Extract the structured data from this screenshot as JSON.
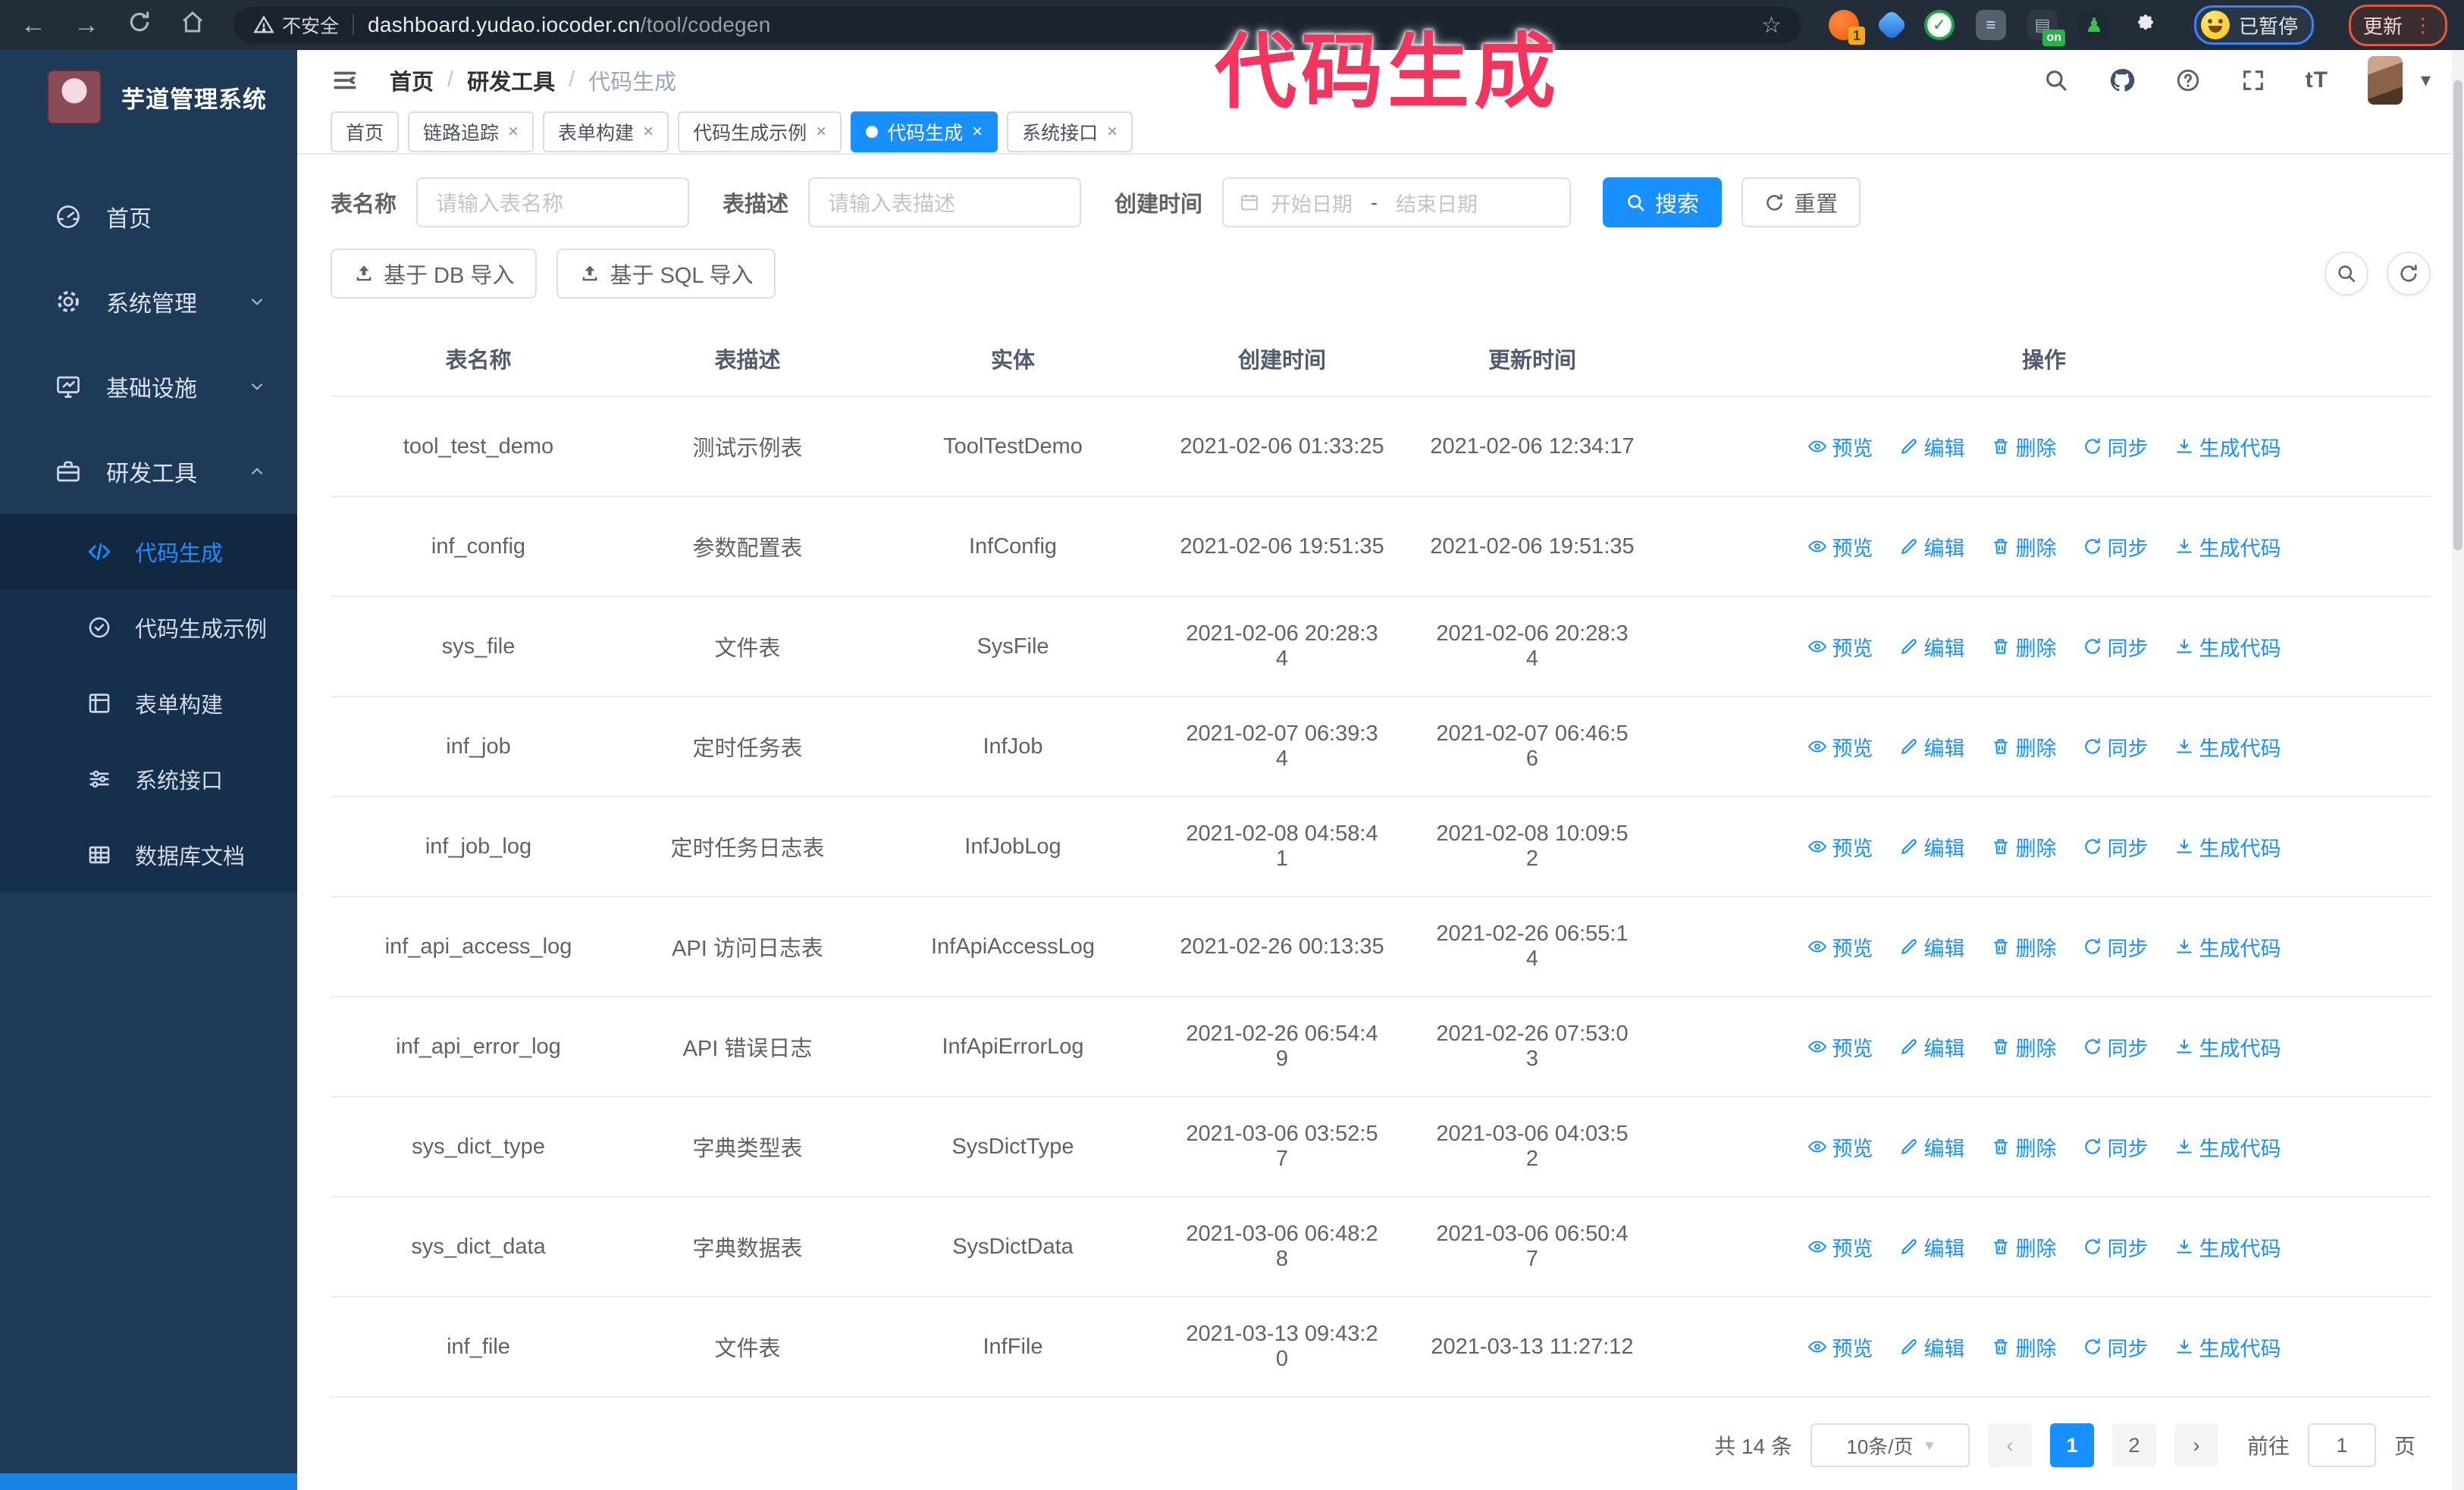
{
  "colors": {
    "accent": "#1890ff",
    "sidebar_bg": "#1e3a57",
    "annotation_pink": "#f2355f",
    "browser_bar": "#232d39"
  },
  "annotation": {
    "text": "代码生成"
  },
  "browser": {
    "back": "←",
    "forward": "→",
    "security_label": "不安全",
    "url_host": "dashboard.yudao.iocoder.cn",
    "url_path": "/tool/codegen",
    "star": "☆",
    "ext_badge": "1",
    "ext_on_badge": "on",
    "paused_badge": "已暂停",
    "update_button": "更新",
    "kebab": "⋮"
  },
  "sidebar": {
    "title": "芋道管理系统",
    "items": [
      {
        "label": "首页",
        "icon": "dashboard-icon",
        "expandable": false
      },
      {
        "label": "系统管理",
        "icon": "gear-icon",
        "expandable": true
      },
      {
        "label": "基础设施",
        "icon": "monitor-icon",
        "expandable": true
      },
      {
        "label": "研发工具",
        "icon": "toolbox-icon",
        "expandable": true,
        "expanded": true
      }
    ],
    "subitems": [
      {
        "label": "代码生成",
        "icon": "code-icon",
        "active": true
      },
      {
        "label": "代码生成示例",
        "icon": "badge-check-icon",
        "active": false
      },
      {
        "label": "表单构建",
        "icon": "form-icon",
        "active": false
      },
      {
        "label": "系统接口",
        "icon": "sliders-icon",
        "active": false
      },
      {
        "label": "数据库文档",
        "icon": "db-doc-icon",
        "active": false
      }
    ]
  },
  "header": {
    "breadcrumb": [
      "首页",
      "研发工具",
      "代码生成"
    ],
    "breadcrumb_sep": "/",
    "font_size_icon": "tT",
    "caret": "▾"
  },
  "tabs": {
    "close_char": "×",
    "list": [
      {
        "label": "首页",
        "closable": false,
        "active": false
      },
      {
        "label": "链路追踪",
        "closable": true,
        "active": false
      },
      {
        "label": "表单构建",
        "closable": true,
        "active": false
      },
      {
        "label": "代码生成示例",
        "closable": true,
        "active": false
      },
      {
        "label": "代码生成",
        "closable": true,
        "active": true
      },
      {
        "label": "系统接口",
        "closable": true,
        "active": false
      }
    ]
  },
  "filters": {
    "table_name_label": "表名称",
    "table_name_placeholder": "请输入表名称",
    "table_desc_label": "表描述",
    "table_desc_placeholder": "请输入表描述",
    "create_time_label": "创建时间",
    "date_start_placeholder": "开始日期",
    "date_separator": "-",
    "date_end_placeholder": "结束日期",
    "search_label": "搜索",
    "reset_label": "重置"
  },
  "toolbar": {
    "import_db_label": "基于 DB 导入",
    "import_sql_label": "基于 SQL 导入"
  },
  "table": {
    "columns": [
      "表名称",
      "表描述",
      "实体",
      "创建时间",
      "更新时间",
      "操作"
    ],
    "actions": [
      {
        "label": "预览",
        "icon": "eye"
      },
      {
        "label": "编辑",
        "icon": "edit"
      },
      {
        "label": "删除",
        "icon": "delete"
      },
      {
        "label": "同步",
        "icon": "sync"
      },
      {
        "label": "生成代码",
        "icon": "download"
      }
    ],
    "rows": [
      {
        "name": "tool_test_demo",
        "desc": "测试示例表",
        "entity": "ToolTestDemo",
        "created": "2021-02-06 01:33:25",
        "updated": "2021-02-06 12:34:17"
      },
      {
        "name": "inf_config",
        "desc": "参数配置表",
        "entity": "InfConfig",
        "created": "2021-02-06 19:51:35",
        "updated": "2021-02-06 19:51:35"
      },
      {
        "name": "sys_file",
        "desc": "文件表",
        "entity": "SysFile",
        "created": "2021-02-06 20:28:3\n4",
        "updated": "2021-02-06 20:28:3\n4"
      },
      {
        "name": "inf_job",
        "desc": "定时任务表",
        "entity": "InfJob",
        "created": "2021-02-07 06:39:3\n4",
        "updated": "2021-02-07 06:46:5\n6"
      },
      {
        "name": "inf_job_log",
        "desc": "定时任务日志表",
        "entity": "InfJobLog",
        "created": "2021-02-08 04:58:4\n1",
        "updated": "2021-02-08 10:09:5\n2"
      },
      {
        "name": "inf_api_access_log",
        "desc": "API 访问日志表",
        "entity": "InfApiAccessLog",
        "created": "2021-02-26 00:13:35",
        "updated": "2021-02-26 06:55:1\n4"
      },
      {
        "name": "inf_api_error_log",
        "desc": "API 错误日志",
        "entity": "InfApiErrorLog",
        "created": "2021-02-26 06:54:4\n9",
        "updated": "2021-02-26 07:53:0\n3"
      },
      {
        "name": "sys_dict_type",
        "desc": "字典类型表",
        "entity": "SysDictType",
        "created": "2021-03-06 03:52:5\n7",
        "updated": "2021-03-06 04:03:5\n2"
      },
      {
        "name": "sys_dict_data",
        "desc": "字典数据表",
        "entity": "SysDictData",
        "created": "2021-03-06 06:48:2\n8",
        "updated": "2021-03-06 06:50:4\n7"
      },
      {
        "name": "inf_file",
        "desc": "文件表",
        "entity": "InfFile",
        "created": "2021-03-13 09:43:2\n0",
        "updated": "2021-03-13 11:27:12"
      }
    ]
  },
  "pagination": {
    "total": "共 14 条",
    "page_size": "10条/页",
    "caret": "▾",
    "prev": "‹",
    "next": "›",
    "pages": [
      "1",
      "2"
    ],
    "active_page": "1",
    "goto_label": "前往",
    "goto_value": "1",
    "page_unit": "页"
  }
}
